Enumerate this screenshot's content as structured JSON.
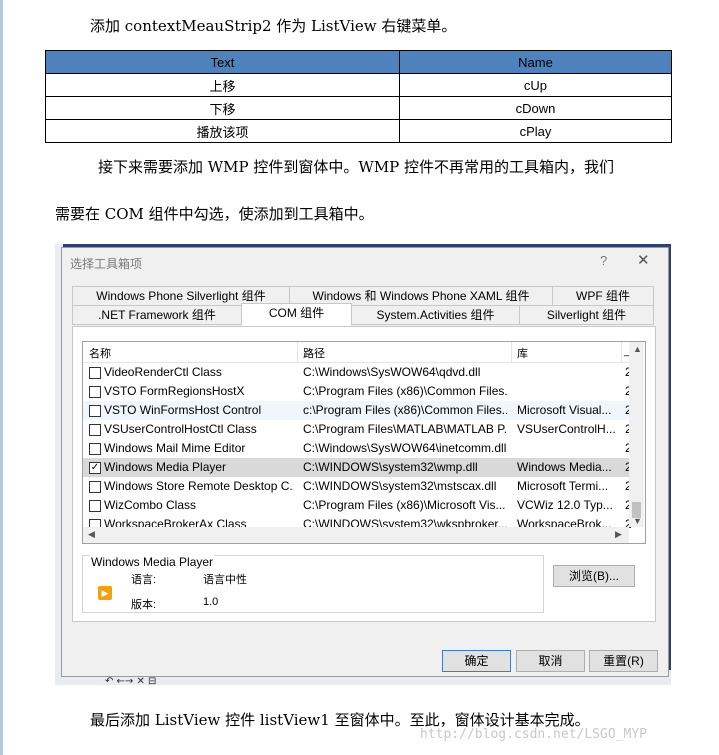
{
  "intro_text": "添加 contextMeauStrip2 作为 ListView 右键菜单。",
  "menu_table": {
    "headers": [
      "Text",
      "Name"
    ],
    "rows": [
      [
        "上移",
        "cUp"
      ],
      [
        "下移",
        "cDown"
      ],
      [
        "播放该项",
        "cPlay"
      ]
    ],
    "header_color": "#4f81bd"
  },
  "para_line1": "接下来需要添加 WMP 控件到窗体中。WMP 控件不再常用的工具箱内，我们",
  "para_line2": "需要在 COM 组件中勾选，使添加到工具箱中。",
  "dialog": {
    "title": "选择工具箱项",
    "help_glyph": "?",
    "close_glyph": "✕",
    "tabs_top": [
      "Windows Phone Silverlight 组件",
      "Windows 和 Windows Phone XAML 组件",
      "WPF 组件"
    ],
    "tabs_bottom": [
      ".NET Framework 组件",
      "COM 组件",
      "System.Activities 组件",
      "Silverlight 组件"
    ],
    "active_tab": "COM 组件",
    "columns": [
      "名称",
      "路径",
      "库",
      "_"
    ],
    "rows": [
      {
        "checked": false,
        "name": "VideoRenderCtl Class",
        "path": "C:\\Windows\\SysWOW64\\qdvd.dll",
        "lib": "",
        "extra": "2"
      },
      {
        "checked": false,
        "name": "VSTO FormRegionsHostX",
        "path": "C:\\Program Files (x86)\\Common Files...",
        "lib": "",
        "extra": "2"
      },
      {
        "checked": false,
        "name": "VSTO WinFormsHost Control",
        "path": "c:\\Program Files (x86)\\Common Files...",
        "lib": "Microsoft Visual...",
        "extra": "2"
      },
      {
        "checked": false,
        "name": "VSUserControlHostCtl Class",
        "path": "C:\\Program Files\\MATLAB\\MATLAB P...",
        "lib": "VSUserControlH...",
        "extra": "2"
      },
      {
        "checked": false,
        "name": "Windows Mail Mime Editor",
        "path": "C:\\Windows\\SysWOW64\\inetcomm.dll",
        "lib": "",
        "extra": "2"
      },
      {
        "checked": true,
        "name": "Windows Media Player",
        "path": "C:\\WINDOWS\\system32\\wmp.dll",
        "lib": "Windows Media...",
        "extra": "2"
      },
      {
        "checked": false,
        "name": "Windows Store Remote Desktop C...",
        "path": "C:\\WINDOWS\\system32\\mstscax.dll",
        "lib": "Microsoft Termi...",
        "extra": "2"
      },
      {
        "checked": false,
        "name": "WizCombo Class",
        "path": "C:\\Program Files (x86)\\Microsoft Vis...",
        "lib": "VCWiz 12.0 Typ...",
        "extra": "2"
      },
      {
        "checked": false,
        "name": "WorkspaceBrokerAx Class",
        "path": "C:\\WINDOWS\\system32\\wkspbroker...",
        "lib": "WorkspaceBrok...",
        "extra": "2"
      }
    ],
    "details": {
      "title": "Windows Media Player",
      "language_label": "语言:",
      "language_value": "语言中性",
      "version_label": "版本:",
      "version_value": "1.0"
    },
    "browse_button": "浏览(B)...",
    "ok_button": "确定",
    "cancel_button": "取消",
    "reset_button": "重置(R)",
    "icon_wmp": "wmp-play-icon"
  },
  "toolbar_glyphs": "↶  ←→  ✕  ⊟",
  "closing_text": "最后添加 ListView 控件 listView1 至窗体中。至此，窗体设计基本完成。",
  "watermark": "http://blog.csdn.net/LSGO_MYP"
}
